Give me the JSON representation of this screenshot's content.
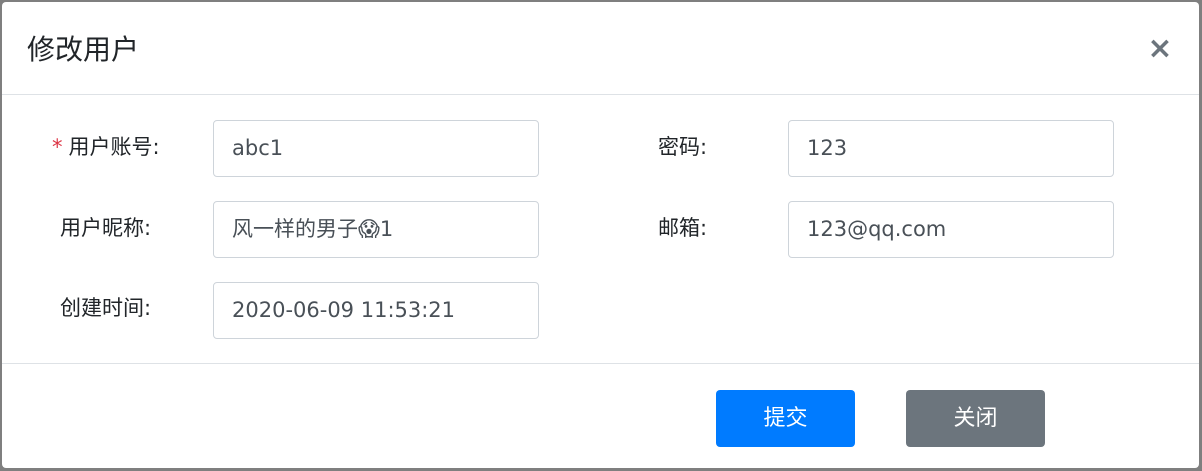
{
  "dialog": {
    "title": "修改用户",
    "close_label": "×"
  },
  "form": {
    "account": {
      "required_mark": "*",
      "label": "用户账号:",
      "value": "abc1"
    },
    "password": {
      "label": "密码:",
      "value": "123"
    },
    "nickname": {
      "label": "用户昵称:",
      "value": "风一样的男子😱1"
    },
    "email": {
      "label": "邮箱:",
      "value": "123@qq.com"
    },
    "created_time": {
      "label": "创建时间:",
      "value": "2020-06-09 11:53:21"
    }
  },
  "footer": {
    "submit_label": "提交",
    "close_label": "关闭"
  },
  "colors": {
    "primary": "#007bff",
    "secondary": "#6c757d",
    "required": "#dc3545"
  }
}
